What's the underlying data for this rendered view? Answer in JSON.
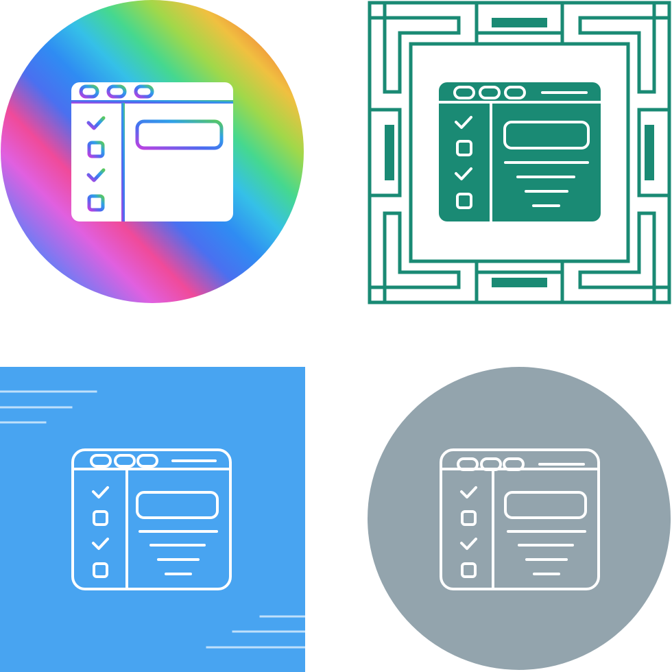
{
  "icon_set": {
    "subject": "browser-checklist-window-icon",
    "variants": [
      {
        "style": "gradient-circle",
        "icon": "browser-checklist-icon",
        "background_icon": "rainbow-circle"
      },
      {
        "style": "glyph-frame",
        "icon": "browser-checklist-icon",
        "background_icon": "square-maze-frame"
      },
      {
        "style": "line-blue-square",
        "icon": "browser-checklist-icon",
        "background_icon": "blue-square"
      },
      {
        "style": "line-gray-circle",
        "icon": "browser-checklist-icon",
        "background_icon": "gray-circle"
      }
    ]
  },
  "colors": {
    "teal": "#1a8a74",
    "blue": "#48a4f1",
    "gray": "#93a4ad",
    "white": "#ffffff",
    "rainbow": [
      "#3a7bf0",
      "#5a8af5",
      "#e060e0",
      "#f04090",
      "#2f8cf2",
      "#35c0e8",
      "#45d890",
      "#a0d84a",
      "#f0c040",
      "#f08040",
      "#f03a30"
    ]
  }
}
